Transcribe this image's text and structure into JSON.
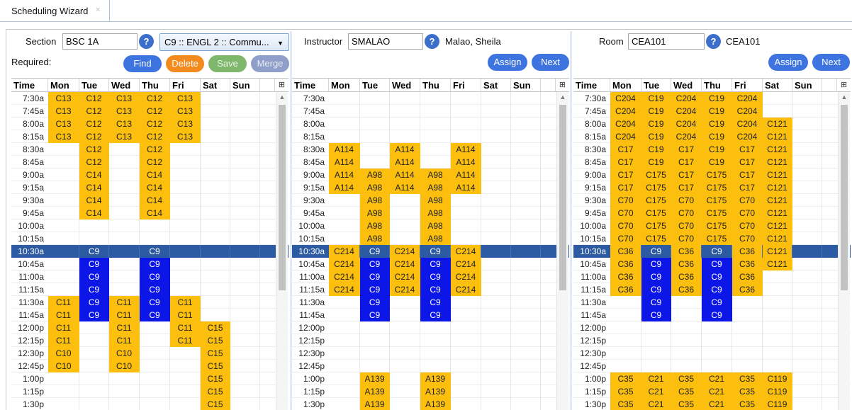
{
  "tab": {
    "title": "Scheduling Wizard",
    "close": "×"
  },
  "section": {
    "label": "Section",
    "value": "BSC 1A",
    "help": "?",
    "subject_combo": "C9 :: ENGL 2 :: Commu...",
    "required_label": "Required:",
    "buttons": {
      "find": "Find",
      "delete": "Delete",
      "save": "Save",
      "merge": "Merge"
    }
  },
  "instructor": {
    "label": "Instructor",
    "value": "SMALAO",
    "help": "?",
    "name": "Malao, Sheila",
    "buttons": {
      "assign": "Assign",
      "next": "Next"
    }
  },
  "room": {
    "label": "Room",
    "value": "CEA101",
    "help": "?",
    "name": "CEA101",
    "buttons": {
      "assign": "Assign",
      "next": "Next"
    }
  },
  "grid_header": {
    "time": "Time",
    "days": [
      "Mon",
      "Tue",
      "Wed",
      "Thu",
      "Fri",
      "Sat",
      "Sun"
    ],
    "corner_icon": "column-chooser-icon",
    "corner_glyph": "⊞"
  },
  "times": [
    "7:30a",
    "7:45a",
    "8:00a",
    "8:15a",
    "8:30a",
    "8:45a",
    "9:00a",
    "9:15a",
    "9:30a",
    "9:45a",
    "10:00a",
    "10:15a",
    "10:30a",
    "10:45a",
    "11:00a",
    "11:15a",
    "11:30a",
    "11:45a",
    "12:00p",
    "12:15p",
    "12:30p",
    "12:45p",
    "1:00p",
    "1:15p",
    "1:30p"
  ],
  "selected_time": "10:30a",
  "colors": {
    "orange": "#fcbf0e",
    "blue": "#0b16e7",
    "selected_row": "#2d5ba3"
  },
  "grids": {
    "section": [
      [
        "C13",
        "C12",
        "C13",
        "C12",
        "C13",
        "",
        ""
      ],
      [
        "C13",
        "C12",
        "C13",
        "C12",
        "C13",
        "",
        ""
      ],
      [
        "C13",
        "C12",
        "C13",
        "C12",
        "C13",
        "",
        ""
      ],
      [
        "C13",
        "C12",
        "C13",
        "C12",
        "C13",
        "",
        ""
      ],
      [
        "",
        "C12",
        "",
        "C12",
        "",
        "",
        ""
      ],
      [
        "",
        "C12",
        "",
        "C12",
        "",
        "",
        ""
      ],
      [
        "",
        "C14",
        "",
        "C14",
        "",
        "",
        ""
      ],
      [
        "",
        "C14",
        "",
        "C14",
        "",
        "",
        ""
      ],
      [
        "",
        "C14",
        "",
        "C14",
        "",
        "",
        ""
      ],
      [
        "",
        "C14",
        "",
        "C14",
        "",
        "",
        ""
      ],
      [
        "",
        "",
        "",
        "",
        "",
        "",
        ""
      ],
      [
        "",
        "",
        "",
        "",
        "",
        "",
        ""
      ],
      [
        "",
        "C9",
        "",
        "C9",
        "",
        "",
        ""
      ],
      [
        "",
        "C9",
        "",
        "C9",
        "",
        "",
        ""
      ],
      [
        "",
        "C9",
        "",
        "C9",
        "",
        "",
        ""
      ],
      [
        "",
        "C9",
        "",
        "C9",
        "",
        "",
        ""
      ],
      [
        "C11",
        "C9",
        "C11",
        "C9",
        "C11",
        "",
        ""
      ],
      [
        "C11",
        "C9",
        "C11",
        "C9",
        "C11",
        "",
        ""
      ],
      [
        "C11",
        "",
        "C11",
        "",
        "C11",
        "C15",
        ""
      ],
      [
        "C11",
        "",
        "C11",
        "",
        "C11",
        "C15",
        ""
      ],
      [
        "C10",
        "",
        "C10",
        "",
        "",
        "C15",
        ""
      ],
      [
        "C10",
        "",
        "C10",
        "",
        "",
        "C15",
        ""
      ],
      [
        "",
        "",
        "",
        "",
        "",
        "C15",
        ""
      ],
      [
        "",
        "",
        "",
        "",
        "",
        "C15",
        ""
      ],
      [
        "",
        "",
        "",
        "",
        "",
        "C15",
        ""
      ]
    ],
    "instructor": [
      [
        "",
        "",
        "",
        "",
        "",
        "",
        ""
      ],
      [
        "",
        "",
        "",
        "",
        "",
        "",
        ""
      ],
      [
        "",
        "",
        "",
        "",
        "",
        "",
        ""
      ],
      [
        "",
        "",
        "",
        "",
        "",
        "",
        ""
      ],
      [
        "A114",
        "",
        "A114",
        "",
        "A114",
        "",
        ""
      ],
      [
        "A114",
        "",
        "A114",
        "",
        "A114",
        "",
        ""
      ],
      [
        "A114",
        "A98",
        "A114",
        "A98",
        "A114",
        "",
        ""
      ],
      [
        "A114",
        "A98",
        "A114",
        "A98",
        "A114",
        "",
        ""
      ],
      [
        "",
        "A98",
        "",
        "A98",
        "",
        "",
        ""
      ],
      [
        "",
        "A98",
        "",
        "A98",
        "",
        "",
        ""
      ],
      [
        "",
        "A98",
        "",
        "A98",
        "",
        "",
        ""
      ],
      [
        "",
        "A98",
        "",
        "A98",
        "",
        "",
        ""
      ],
      [
        "C214",
        "C9",
        "C214",
        "C9",
        "C214",
        "",
        ""
      ],
      [
        "C214",
        "C9",
        "C214",
        "C9",
        "C214",
        "",
        ""
      ],
      [
        "C214",
        "C9",
        "C214",
        "C9",
        "C214",
        "",
        ""
      ],
      [
        "C214",
        "C9",
        "C214",
        "C9",
        "C214",
        "",
        ""
      ],
      [
        "",
        "C9",
        "",
        "C9",
        "",
        "",
        ""
      ],
      [
        "",
        "C9",
        "",
        "C9",
        "",
        "",
        ""
      ],
      [
        "",
        "",
        "",
        "",
        "",
        "",
        ""
      ],
      [
        "",
        "",
        "",
        "",
        "",
        "",
        ""
      ],
      [
        "",
        "",
        "",
        "",
        "",
        "",
        ""
      ],
      [
        "",
        "",
        "",
        "",
        "",
        "",
        ""
      ],
      [
        "",
        "A139",
        "",
        "A139",
        "",
        "",
        ""
      ],
      [
        "",
        "A139",
        "",
        "A139",
        "",
        "",
        ""
      ],
      [
        "",
        "A139",
        "",
        "A139",
        "",
        "",
        ""
      ]
    ],
    "room": [
      [
        "C204",
        "C19",
        "C204",
        "C19",
        "C204",
        "",
        ""
      ],
      [
        "C204",
        "C19",
        "C204",
        "C19",
        "C204",
        "",
        ""
      ],
      [
        "C204",
        "C19",
        "C204",
        "C19",
        "C204",
        "C121",
        ""
      ],
      [
        "C204",
        "C19",
        "C204",
        "C19",
        "C204",
        "C121",
        ""
      ],
      [
        "C17",
        "C19",
        "C17",
        "C19",
        "C17",
        "C121",
        ""
      ],
      [
        "C17",
        "C19",
        "C17",
        "C19",
        "C17",
        "C121",
        ""
      ],
      [
        "C17",
        "C175",
        "C17",
        "C175",
        "C17",
        "C121",
        ""
      ],
      [
        "C17",
        "C175",
        "C17",
        "C175",
        "C17",
        "C121",
        ""
      ],
      [
        "C70",
        "C175",
        "C70",
        "C175",
        "C70",
        "C121",
        ""
      ],
      [
        "C70",
        "C175",
        "C70",
        "C175",
        "C70",
        "C121",
        ""
      ],
      [
        "C70",
        "C175",
        "C70",
        "C175",
        "C70",
        "C121",
        ""
      ],
      [
        "C70",
        "C175",
        "C70",
        "C175",
        "C70",
        "C121",
        ""
      ],
      [
        "C36",
        "C9",
        "C36",
        "C9",
        "C36",
        "C121",
        ""
      ],
      [
        "C36",
        "C9",
        "C36",
        "C9",
        "C36",
        "C121",
        ""
      ],
      [
        "C36",
        "C9",
        "C36",
        "C9",
        "C36",
        "",
        ""
      ],
      [
        "C36",
        "C9",
        "C36",
        "C9",
        "C36",
        "",
        ""
      ],
      [
        "",
        "C9",
        "",
        "C9",
        "",
        "",
        ""
      ],
      [
        "",
        "C9",
        "",
        "C9",
        "",
        "",
        ""
      ],
      [
        "",
        "",
        "",
        "",
        "",
        "",
        ""
      ],
      [
        "",
        "",
        "",
        "",
        "",
        "",
        ""
      ],
      [
        "",
        "",
        "",
        "",
        "",
        "",
        ""
      ],
      [
        "",
        "",
        "",
        "",
        "",
        "",
        ""
      ],
      [
        "C35",
        "C21",
        "C35",
        "C21",
        "C35",
        "C119",
        ""
      ],
      [
        "C35",
        "C21",
        "C35",
        "C21",
        "C35",
        "C119",
        ""
      ],
      [
        "C35",
        "C21",
        "C35",
        "C21",
        "C35",
        "C119",
        ""
      ]
    ]
  }
}
